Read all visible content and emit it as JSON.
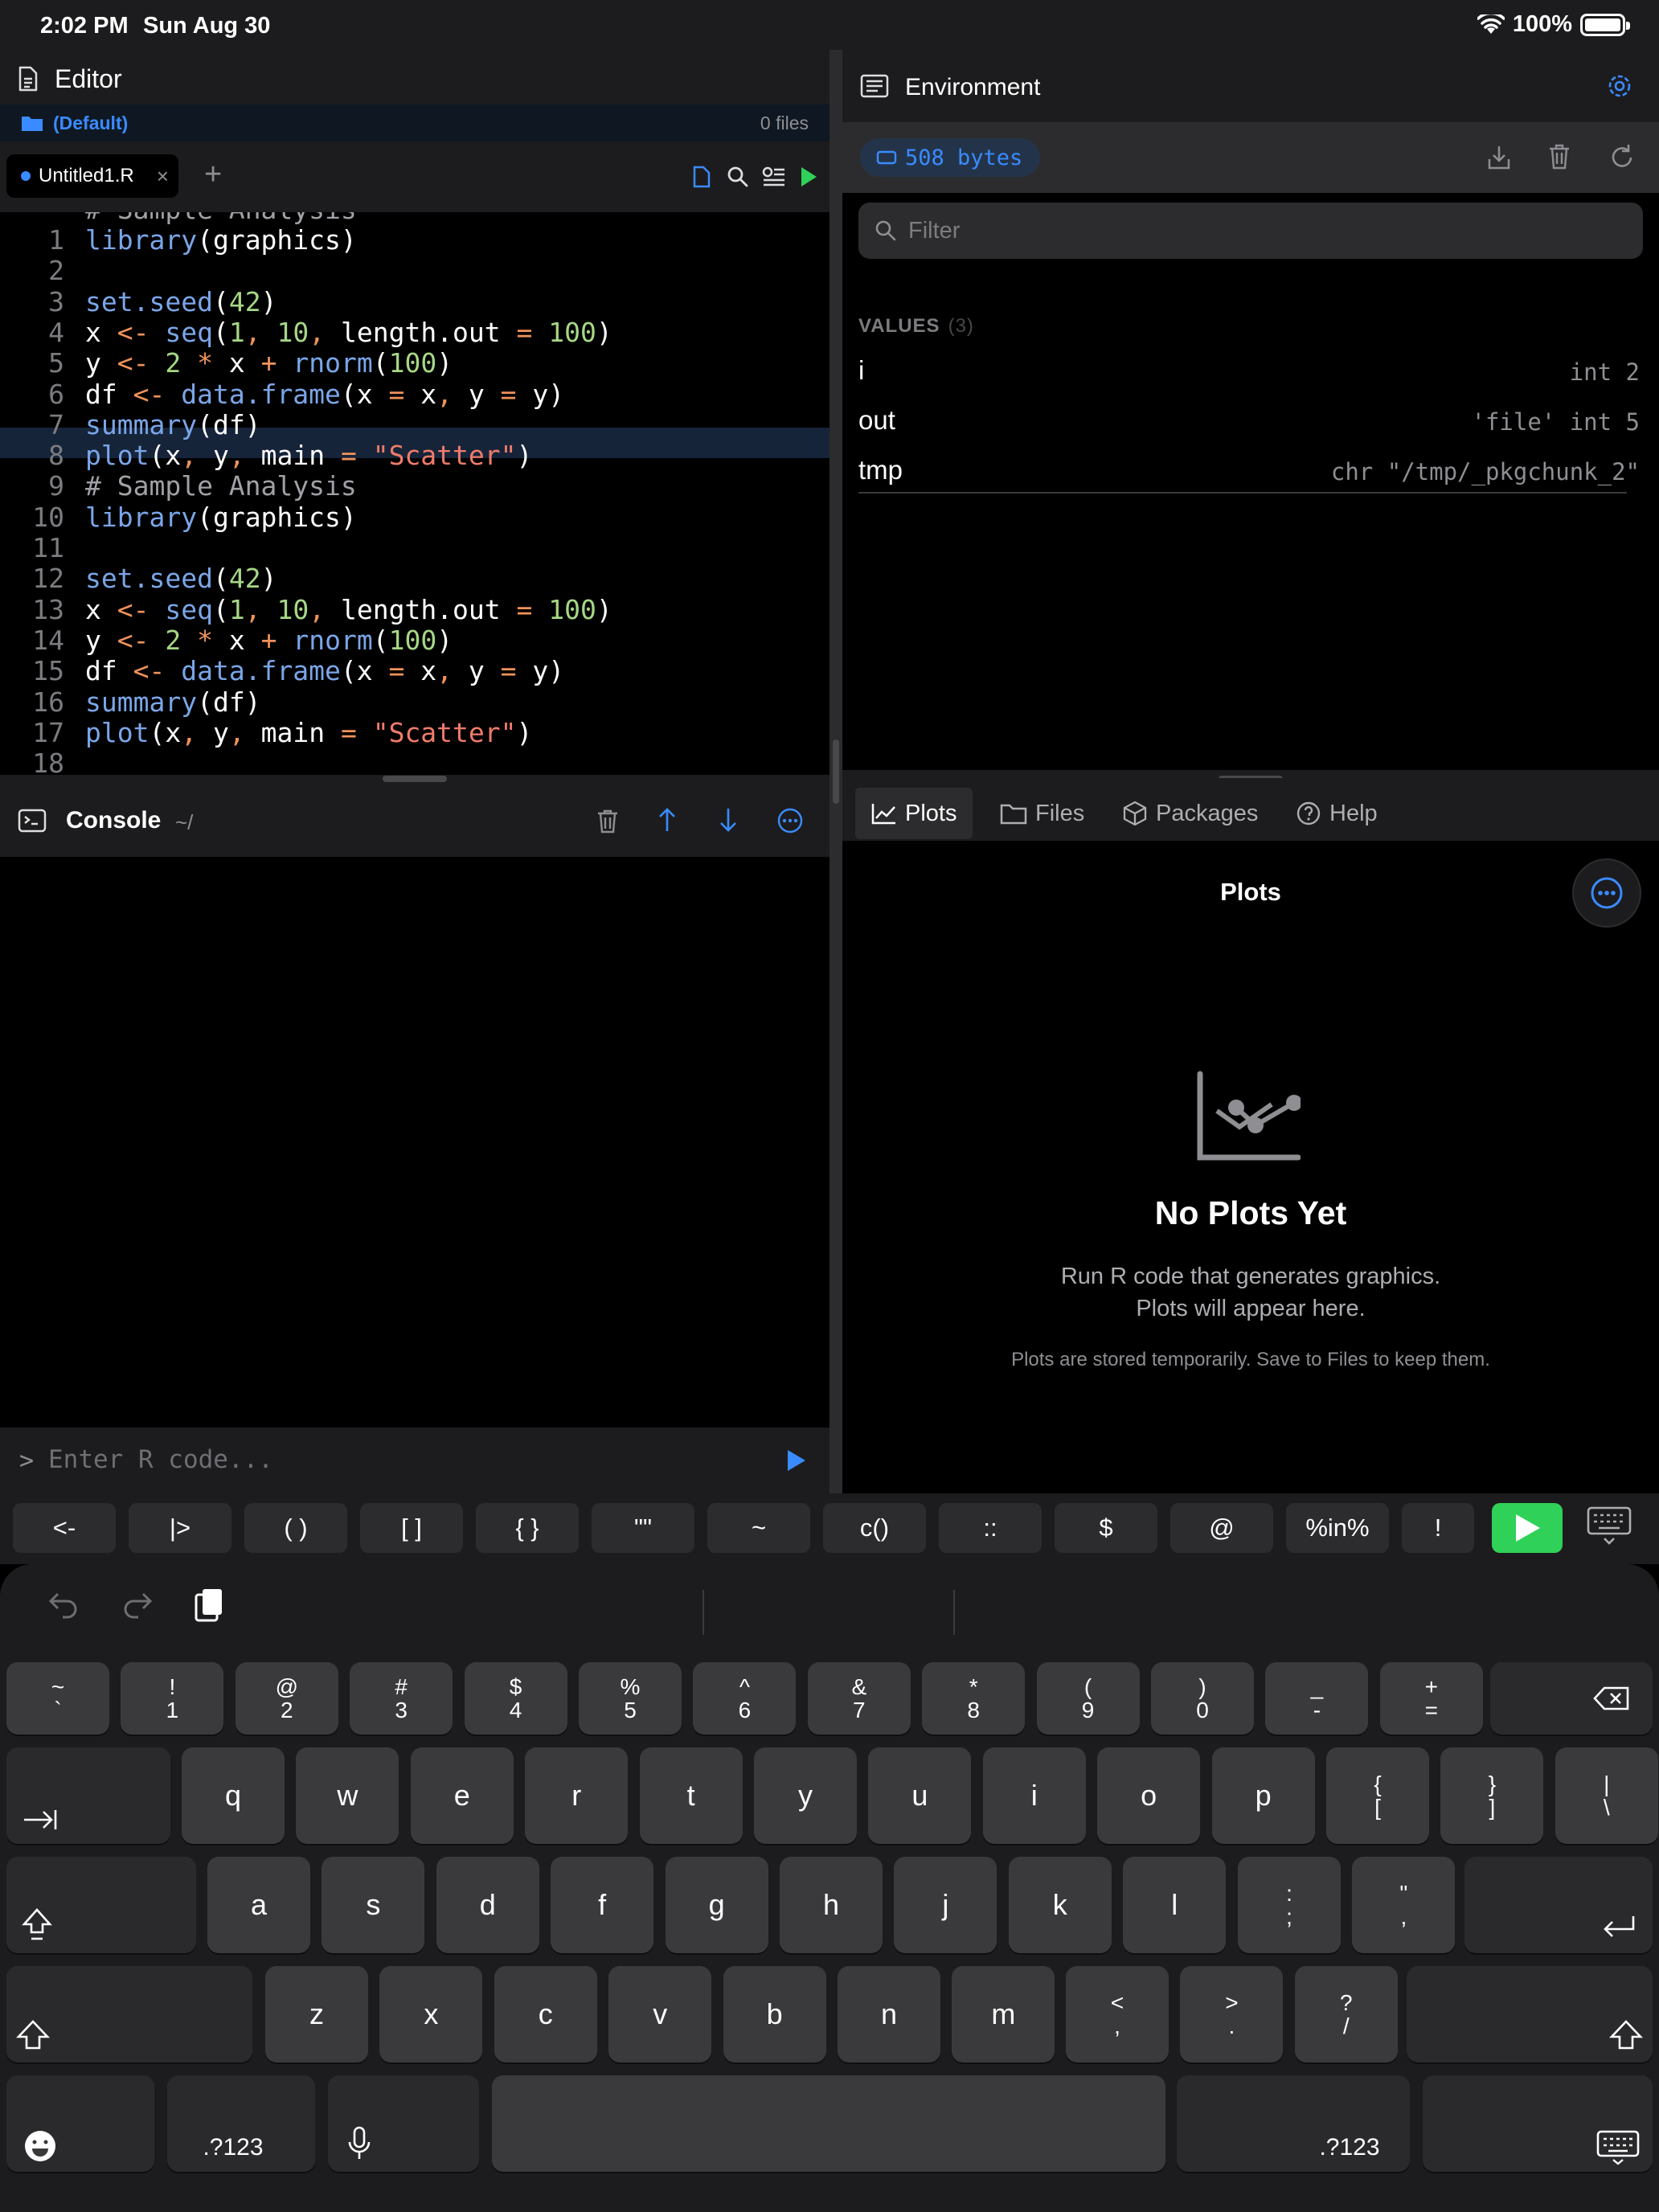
{
  "status_bar": {
    "time": "2:02 PM",
    "date": "Sun Aug 30",
    "battery": "100%"
  },
  "editor": {
    "title": "Editor",
    "project": "(Default)",
    "file_count": "0 files",
    "tab_label": "Untitled1.R",
    "tab_close": "×",
    "tab_add": "+",
    "top_partial": "# Sample Analysis",
    "line_numbers": [
      "1",
      "2",
      "3",
      "4",
      "5",
      "6",
      "7",
      "8",
      "9",
      "10",
      "11",
      "12",
      "13",
      "14",
      "15",
      "16",
      "17",
      "18"
    ]
  },
  "console": {
    "title": "Console",
    "path": "~/",
    "prompt": ">",
    "placeholder": "Enter R code..."
  },
  "environment": {
    "title": "Environment",
    "memory": "508 bytes",
    "filter_placeholder": "Filter",
    "values_label": "VALUES",
    "values_count": "(3)",
    "variables": [
      {
        "name": "i",
        "value": "int 2"
      },
      {
        "name": "out",
        "value": "'file' int 5"
      },
      {
        "name": "tmp",
        "value": "chr \"/tmp/_pkgchunk_2\""
      }
    ]
  },
  "pane_tabs": [
    {
      "label": "Plots",
      "icon": "chart-icon",
      "active": true
    },
    {
      "label": "Files",
      "icon": "folder-icon",
      "active": false
    },
    {
      "label": "Packages",
      "icon": "package-icon",
      "active": false
    },
    {
      "label": "Help",
      "icon": "help-icon",
      "active": false
    }
  ],
  "plots": {
    "title": "Plots",
    "empty_title": "No Plots Yet",
    "empty_line1": "Run R code that generates graphics.",
    "empty_line2": "Plots will appear here.",
    "empty_note": "Plots are stored temporarily. Save to Files to keep them."
  },
  "shortcuts": [
    "<-",
    "|>",
    "( )",
    "[ ]",
    "{ }",
    "\"\"",
    "~",
    "c()",
    "::",
    "$",
    "@",
    "%in%",
    "!"
  ],
  "keyboard": {
    "row1": [
      {
        "top": "~",
        "bot": "`"
      },
      {
        "top": "!",
        "bot": "1"
      },
      {
        "top": "@",
        "bot": "2"
      },
      {
        "top": "#",
        "bot": "3"
      },
      {
        "top": "$",
        "bot": "4"
      },
      {
        "top": "%",
        "bot": "5"
      },
      {
        "top": "^",
        "bot": "6"
      },
      {
        "top": "&",
        "bot": "7"
      },
      {
        "top": "*",
        "bot": "8"
      },
      {
        "top": "(",
        "bot": "9"
      },
      {
        "top": ")",
        "bot": "0"
      },
      {
        "top": "_",
        "bot": "-"
      },
      {
        "top": "+",
        "bot": "="
      }
    ],
    "row2": [
      "q",
      "w",
      "e",
      "r",
      "t",
      "y",
      "u",
      "i",
      "o",
      "p"
    ],
    "row2_extra": [
      {
        "top": "{",
        "bot": "["
      },
      {
        "top": "}",
        "bot": "]"
      },
      {
        "top": "|",
        "bot": "\\"
      }
    ],
    "row3": [
      "a",
      "s",
      "d",
      "f",
      "g",
      "h",
      "j",
      "k",
      "l"
    ],
    "row3_extra": [
      {
        "top": ":",
        "bot": ";"
      },
      {
        "top": "\"",
        "bot": ","
      }
    ],
    "row4": [
      "z",
      "x",
      "c",
      "v",
      "b",
      "n",
      "m"
    ],
    "row4_extra": [
      {
        "top": "<",
        "bot": ","
      },
      {
        "top": ">",
        "bot": "."
      },
      {
        "top": "?",
        "bot": "/"
      }
    ],
    "numbers_label": ".?123"
  },
  "colors": {
    "accent": "#3a8bff",
    "run_green": "#30d158",
    "panel": "#1c1c1e",
    "background": "#000000"
  }
}
